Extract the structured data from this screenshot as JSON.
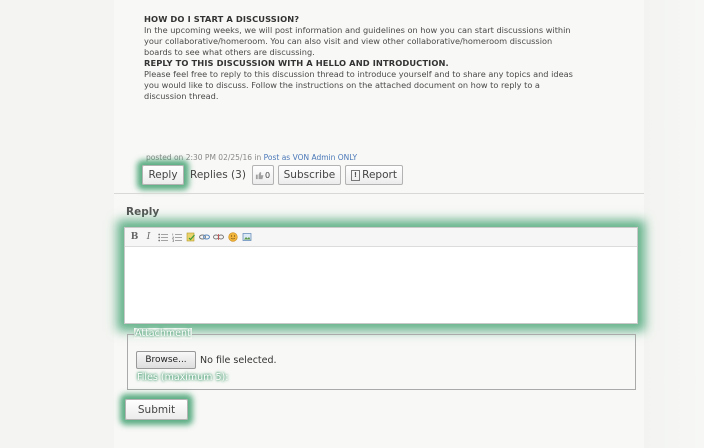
{
  "post": {
    "heading1": "HOW DO I START A DISCUSSION?",
    "para1_line1": "In the upcoming weeks, we will post information and guidelines on how you can start discussions within",
    "para1_line2": "your collaborative/homeroom.  You can also visit and view other collaborative/homeroom discussion",
    "para1_line3": "boards to see what others are discussing.",
    "heading2": "REPLY TO THIS DISCUSSION WITH A HELLO AND INTRODUCTION.",
    "para2_line1": "Please feel free to reply to this discussion thread to introduce yourself and to share any topics and ideas",
    "para2_line2": "you would like to discuss.  Follow the instructions on the attached document on how to reply to a",
    "para2_line3": "discussion thread.",
    "meta_prefix": "posted on",
    "meta_time": "2:30 PM 02/25/16",
    "meta_in": "in",
    "meta_location": "Post as VON Admin ONLY"
  },
  "actions": {
    "reply": "Reply",
    "replies": "Replies (3)",
    "like_count": "0",
    "subscribe": "Subscribe",
    "report": "Report"
  },
  "reply_form": {
    "title": "Reply",
    "editor_value": "",
    "toolbar": [
      "bold",
      "italic",
      "bulleted-list",
      "numbered-list",
      "spellcheck",
      "link",
      "unlink",
      "smiley",
      "image"
    ],
    "attachment_legend": "Attachment",
    "browse": "Browse...",
    "no_file": "No file selected.",
    "files_max": "Files (maximum 5):",
    "submit": "Submit"
  },
  "colors": {
    "highlight": "#2a965f",
    "panel_bg": "#f8f8f6"
  }
}
